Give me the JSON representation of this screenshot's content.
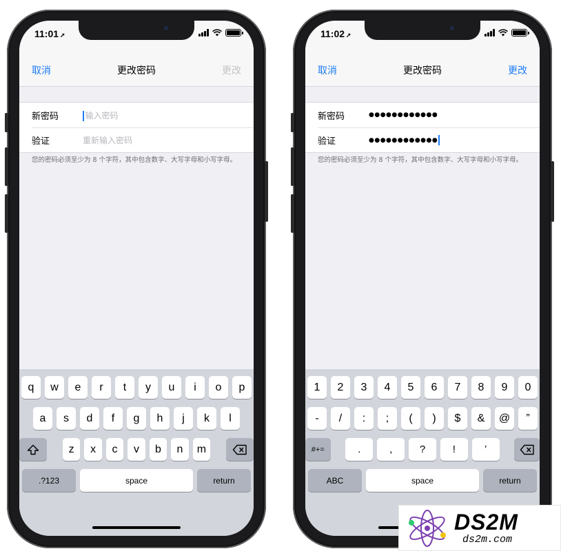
{
  "phones": [
    {
      "time": "11:01",
      "nav": {
        "cancel": "取消",
        "title": "更改密码",
        "change": "更改",
        "change_enabled": false
      },
      "fields": [
        {
          "label": "新密码",
          "value": "输入密码",
          "placeholder": true
        },
        {
          "label": "验证",
          "value": "重新输入密码",
          "placeholder": true
        }
      ],
      "hint": "您的密码必须至少为 8 个字符，其中包含数字、大写字母和小写字母。",
      "keyboard": {
        "row1": [
          "q",
          "w",
          "e",
          "r",
          "t",
          "y",
          "u",
          "i",
          "o",
          "p"
        ],
        "row2": [
          "a",
          "s",
          "d",
          "f",
          "g",
          "h",
          "j",
          "k",
          "l"
        ],
        "row3": [
          "z",
          "x",
          "c",
          "v",
          "b",
          "n",
          "m"
        ],
        "mode_key": ".?123",
        "space": "space",
        "return": "return"
      }
    },
    {
      "time": "11:02",
      "nav": {
        "cancel": "取消",
        "title": "更改密码",
        "change": "更改",
        "change_enabled": true
      },
      "fields": [
        {
          "label": "新密码",
          "value": "●●●●●●●●●●●●",
          "placeholder": false
        },
        {
          "label": "验证",
          "value": "●●●●●●●●●●●●",
          "placeholder": false
        }
      ],
      "hint": "您的密码必须至少为 8 个字符，其中包含数字、大写字母和小写字母。",
      "keyboard": {
        "row1": [
          "1",
          "2",
          "3",
          "4",
          "5",
          "6",
          "7",
          "8",
          "9",
          "0"
        ],
        "row2": [
          "-",
          "/",
          ":",
          ";",
          "(",
          ")",
          "$",
          "&",
          "@",
          "”"
        ],
        "row3": [
          ".",
          ",",
          "?",
          "!",
          "’"
        ],
        "shift_key": "#+=",
        "mode_key": "ABC",
        "space": "space",
        "return": "return"
      }
    }
  ],
  "watermark": {
    "brand": "DS2M",
    "domain": "ds2m.com"
  },
  "colors": {
    "accent": "#1b7cf6",
    "disabled": "#c4c4c8",
    "keyboard_bg": "#d2d5db"
  },
  "icons": [
    "location-arrow-icon",
    "signal-icon",
    "wifi-icon",
    "battery-icon",
    "shift-icon",
    "backspace-icon"
  ]
}
